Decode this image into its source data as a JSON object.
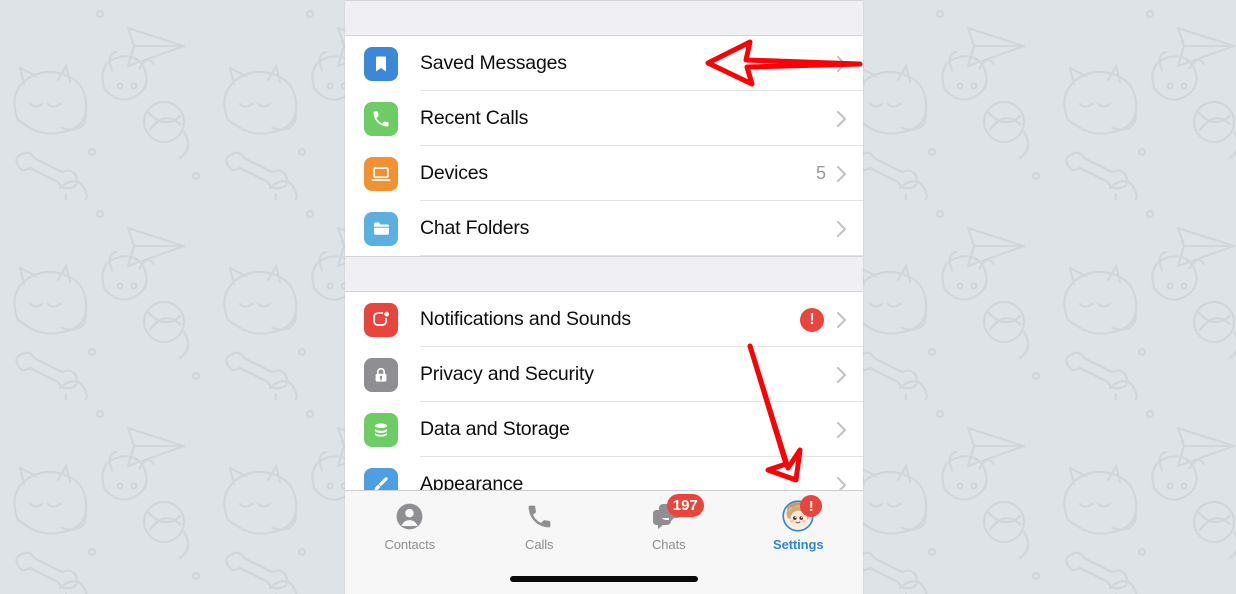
{
  "app": {
    "name": "Telegram",
    "screen": "Settings"
  },
  "background": {
    "description": "telegram-doodle-wallpaper",
    "base_color": "#dde3e7",
    "doodle_color": "#cfd7dd"
  },
  "settings_groups": [
    {
      "id": "group-primary",
      "rows": [
        {
          "label": "Saved Messages",
          "icon": "bookmark-icon",
          "icon_color": "#3b88d6",
          "value": "",
          "badge": "",
          "chevron": true
        },
        {
          "label": "Recent Calls",
          "icon": "phone-icon",
          "icon_color": "#6dcc63",
          "value": "",
          "badge": "",
          "chevron": true
        },
        {
          "label": "Devices",
          "icon": "laptop-icon",
          "icon_color": "#f09134",
          "value": "5",
          "badge": "",
          "chevron": true
        },
        {
          "label": "Chat Folders",
          "icon": "folder-icon",
          "icon_color": "#5bb0e0",
          "value": "",
          "badge": "",
          "chevron": true
        }
      ]
    },
    {
      "id": "group-secondary",
      "rows": [
        {
          "label": "Notifications and Sounds",
          "icon": "notification-bell-icon",
          "icon_color": "#e8453c",
          "value": "",
          "badge": "!",
          "chevron": true
        },
        {
          "label": "Privacy and Security",
          "icon": "lock-icon",
          "icon_color": "#8e8e93",
          "value": "",
          "badge": "",
          "chevron": true
        },
        {
          "label": "Data and Storage",
          "icon": "database-icon",
          "icon_color": "#6dcc63",
          "value": "",
          "badge": "",
          "chevron": true
        },
        {
          "label": "Appearance",
          "icon": "paintbrush-icon",
          "icon_color": "#4e9fe0",
          "value": "",
          "badge": "",
          "chevron": true
        }
      ]
    }
  ],
  "tabbar": {
    "tabs": [
      {
        "label": "Contacts",
        "icon": "person-icon",
        "badge": "",
        "active": false
      },
      {
        "label": "Calls",
        "icon": "phone-icon",
        "badge": "",
        "active": false
      },
      {
        "label": "Chats",
        "icon": "chats-icon",
        "badge": "197",
        "active": false
      },
      {
        "label": "Settings",
        "icon": "avatar-icon",
        "badge": "!",
        "active": true
      }
    ],
    "active_color": "#2f86d8",
    "inactive_color": "#8e8e93",
    "badge_color": "#e8453c"
  },
  "annotations": {
    "color": "#fb0005",
    "arrows": [
      {
        "id": "arrow-left",
        "points_to": "Saved Messages",
        "direction": "left"
      },
      {
        "id": "arrow-down",
        "points_to": "Settings tab",
        "direction": "down-right"
      }
    ]
  }
}
